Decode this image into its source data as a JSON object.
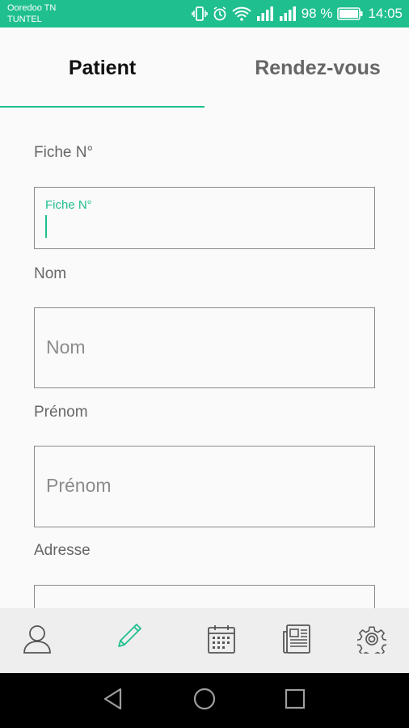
{
  "status_bar": {
    "carrier_line1": "Ooredoo TN",
    "carrier_line2": "TUNTEL",
    "battery_percent": "98 %",
    "time": "14:05",
    "icons": [
      "vibrate-icon",
      "alarm-icon",
      "wifi-icon",
      "signal-icon",
      "signal-icon",
      "battery-icon"
    ]
  },
  "tabs": [
    {
      "label": "Patient",
      "active": true
    },
    {
      "label": "Rendez-vous",
      "active": false
    }
  ],
  "form": {
    "fields": [
      {
        "label": "Fiche N°",
        "placeholder": "Fiche N°",
        "focused": true,
        "value": ""
      },
      {
        "label": "Nom",
        "placeholder": "Nom",
        "focused": false,
        "value": ""
      },
      {
        "label": "Prénom",
        "placeholder": "Prénom",
        "focused": false,
        "value": ""
      },
      {
        "label": "Adresse",
        "placeholder": "",
        "focused": false,
        "value": ""
      }
    ]
  },
  "bottom_nav": {
    "items": [
      "profile-icon",
      "pencil-icon",
      "calendar-icon",
      "newspaper-icon",
      "settings-icon"
    ],
    "active": "pencil-icon"
  },
  "system_nav": [
    "back-icon",
    "home-icon",
    "recents-icon"
  ],
  "colors": {
    "accent": "#1fbf8f",
    "background": "#fafafa",
    "nav_background": "#eeeeee",
    "icon_gray": "#555555"
  }
}
